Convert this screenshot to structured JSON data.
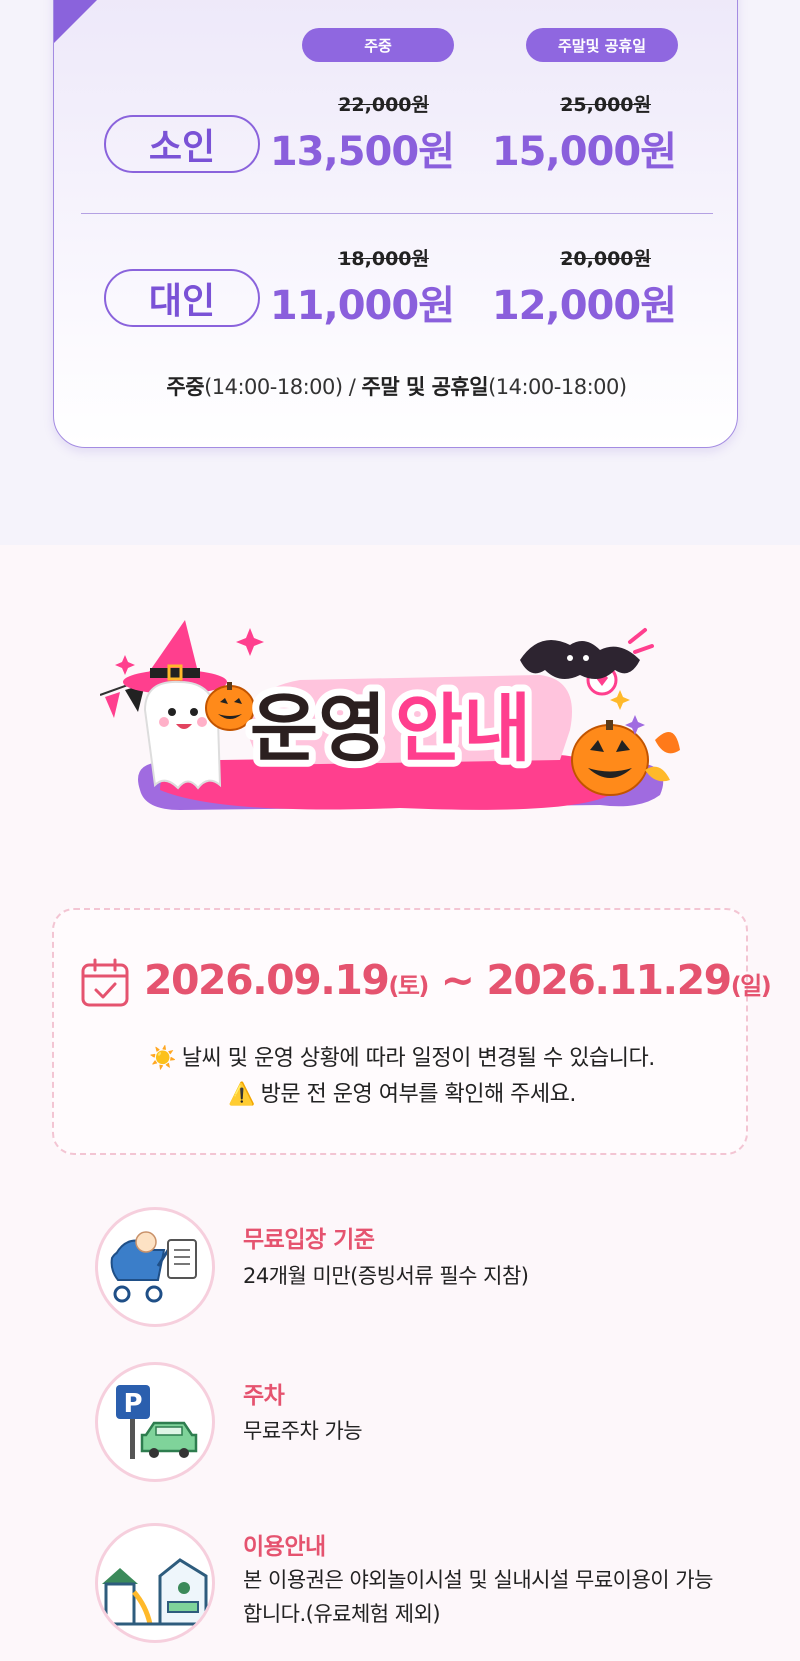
{
  "pricing": {
    "columns": {
      "weekday": "주중",
      "weekend": "주말및 공휴일"
    },
    "rows": [
      {
        "label": "소인",
        "weekday_old": "22,000원",
        "weekday_new": "13,500원",
        "weekend_old": "25,000원",
        "weekend_new": "15,000원"
      },
      {
        "label": "대인",
        "weekday_old": "18,000원",
        "weekday_new": "11,000원",
        "weekend_old": "20,000원",
        "weekend_new": "12,000원"
      }
    ],
    "hours": {
      "weekday_label": "주중",
      "weekday_time": "(14:00-18:00)",
      "sep": " / ",
      "weekend_label": "주말 및 공휴일",
      "weekend_time": "(14:00-18:00)"
    }
  },
  "banner": {
    "part1": "운영",
    "part2": "안내"
  },
  "schedule": {
    "start": "2026.09.19",
    "start_day": "(토)",
    "tilde": " ~ ",
    "end": "2026.11.29",
    "end_day": "(일)",
    "notice1_icon": "☀️",
    "notice1": "날씨 및 운영 상황에 따라 일정이 변경될 수 있습니다.",
    "notice2_icon": "⚠️",
    "notice2": "방문 전 운영 여부를 확인해 주세요."
  },
  "info": [
    {
      "icon": "stroller-icon",
      "title": "무료입장 기준",
      "text": "24개월 미만(증빙서류 필수 지참)"
    },
    {
      "icon": "parking-icon",
      "title": "주차",
      "text": "무료주차 가능"
    },
    {
      "icon": "playground-icon",
      "title": "이용안내",
      "text": "본 이용권은 야외놀이시설 및 실내시설 무료이용이 가능합니다.(유료체험 제외)"
    }
  ],
  "colors": {
    "purple": "#8a63dc",
    "pink": "#e5536f",
    "banner_pink": "#ff3f8e"
  }
}
